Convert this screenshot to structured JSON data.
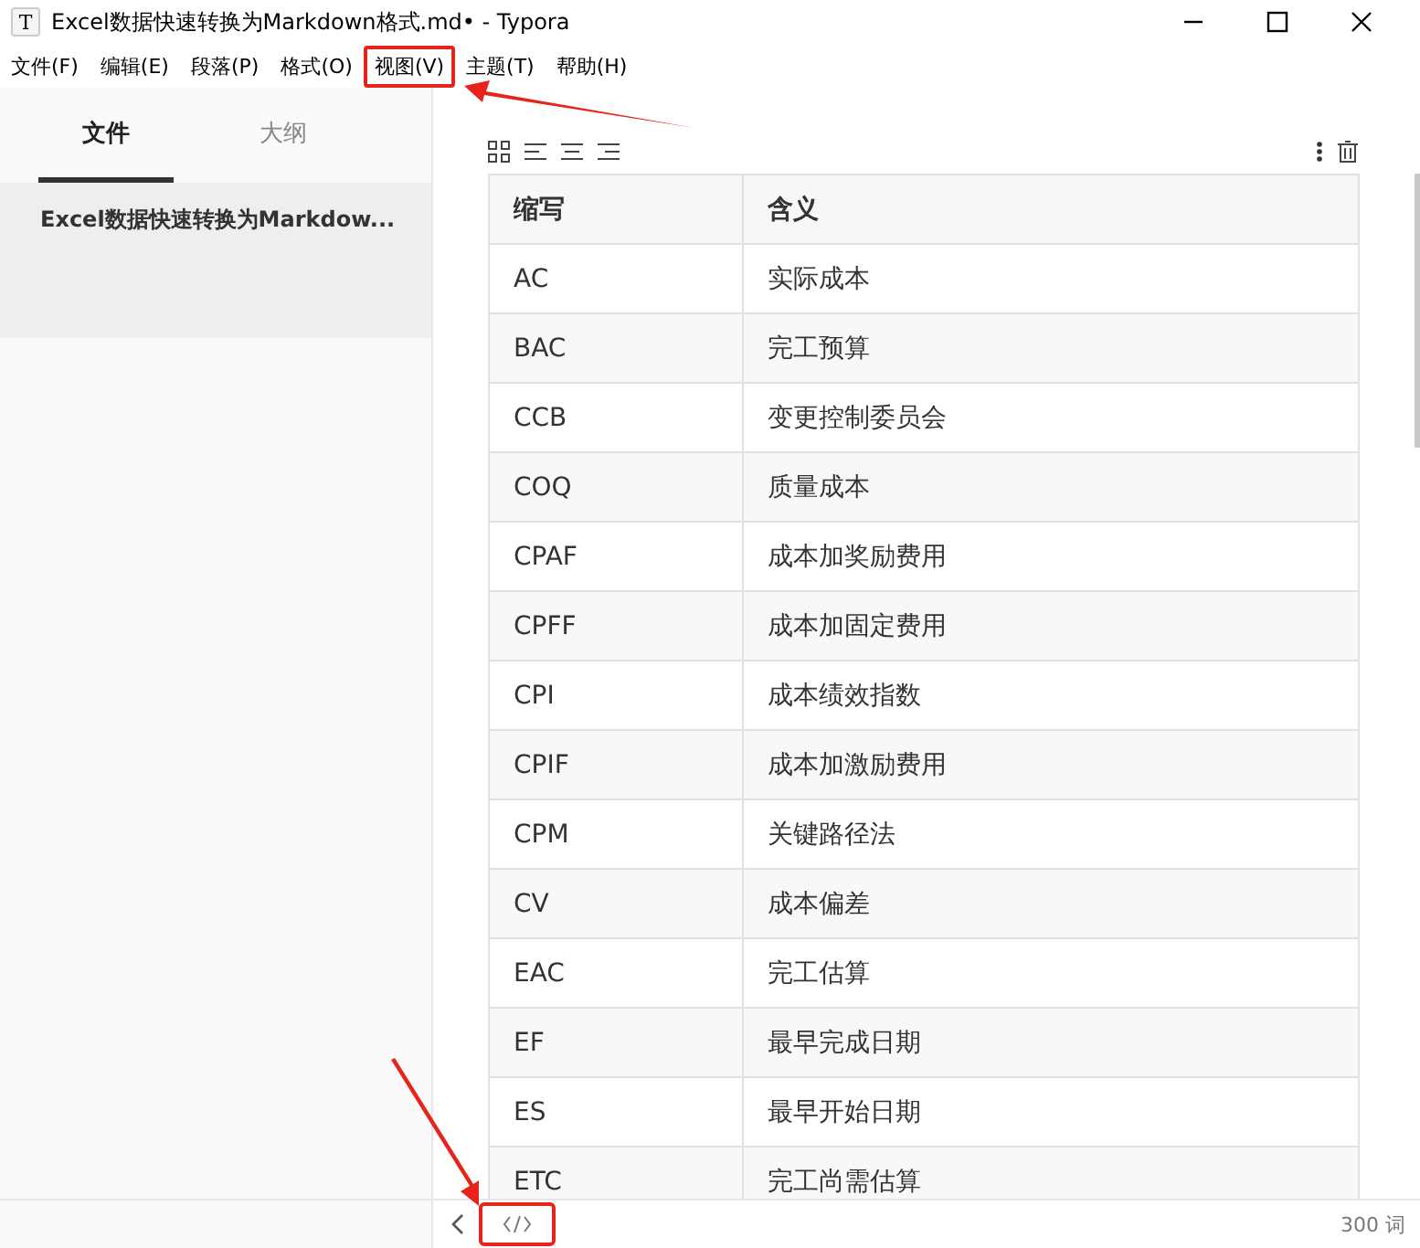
{
  "window": {
    "app_icon": "T",
    "title": "Excel数据快速转换为Markdown格式.md• - Typora"
  },
  "menu": [
    {
      "label": "文件(F)",
      "highlighted": false
    },
    {
      "label": "编辑(E)",
      "highlighted": false
    },
    {
      "label": "段落(P)",
      "highlighted": false
    },
    {
      "label": "格式(O)",
      "highlighted": false
    },
    {
      "label": "视图(V)",
      "highlighted": true
    },
    {
      "label": "主题(T)",
      "highlighted": false
    },
    {
      "label": "帮助(H)",
      "highlighted": false
    }
  ],
  "sidebar": {
    "tabs": [
      {
        "label": "文件",
        "selected": true
      },
      {
        "label": "大纲",
        "selected": false
      }
    ],
    "files": [
      {
        "name": "Excel数据快速转换为Markdow...",
        "selected": true
      }
    ]
  },
  "table": {
    "columns": [
      "缩写",
      "含义"
    ],
    "rows": [
      [
        "AC",
        "实际成本"
      ],
      [
        "BAC",
        "完工预算"
      ],
      [
        "CCB",
        "变更控制委员会"
      ],
      [
        "COQ",
        "质量成本"
      ],
      [
        "CPAF",
        "成本加奖励费用"
      ],
      [
        "CPFF",
        "成本加固定费用"
      ],
      [
        "CPI",
        "成本绩效指数"
      ],
      [
        "CPIF",
        "成本加激励费用"
      ],
      [
        "CPM",
        "关键路径法"
      ],
      [
        "CV",
        "成本偏差"
      ],
      [
        "EAC",
        "完工估算"
      ],
      [
        "EF",
        "最早完成日期"
      ],
      [
        "ES",
        "最早开始日期"
      ],
      [
        "ETC",
        "完工尚需估算"
      ]
    ]
  },
  "status_bar": {
    "source_button_highlighted": true,
    "word_count": "300 词"
  }
}
